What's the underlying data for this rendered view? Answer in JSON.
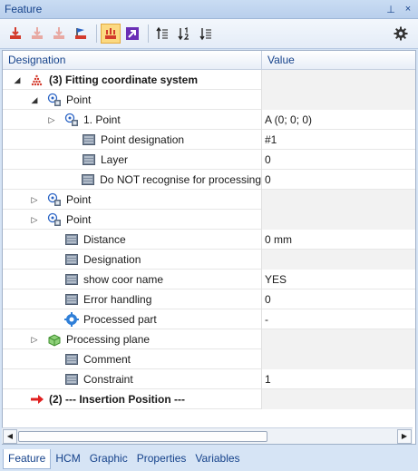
{
  "panel": {
    "title": "Feature",
    "pin_glyph": "⊥",
    "close_glyph": "×"
  },
  "toolbar": {
    "buttons": [
      {
        "icon": "insert-feature-icon"
      },
      {
        "icon": "insert-feature-disabled-icon"
      },
      {
        "icon": "insert-feature-disabled-2-icon"
      },
      {
        "icon": "feature-flag-icon"
      },
      {
        "icon": "feature-active-icon"
      },
      {
        "icon": "arrow-jump-icon"
      },
      {
        "icon": "sort-up-icon"
      },
      {
        "icon": "sort-numeric-icon"
      },
      {
        "icon": "sort-down-icon"
      }
    ],
    "settings_icon": "gear-icon"
  },
  "grid": {
    "columns": [
      "Designation",
      "Value"
    ],
    "rows": [
      {
        "label": "(3) Fitting coordinate system",
        "value": "",
        "bold": true,
        "expander": "open",
        "icon": "coordinate-system-icon",
        "level": 0
      },
      {
        "label": "Point",
        "value": "",
        "expander": "open",
        "icon": "point-icon",
        "level": 1
      },
      {
        "label": "1. Point",
        "value": "A  (0; 0; 0)",
        "expander": "closed",
        "icon": "point-icon",
        "level": 2
      },
      {
        "label": "Point designation",
        "value": "#1",
        "expander": "none",
        "icon": "property-icon",
        "level": 3
      },
      {
        "label": "Layer",
        "value": "0",
        "expander": "none",
        "icon": "property-icon",
        "level": 3
      },
      {
        "label": "Do NOT recognise for processing",
        "value": "0",
        "expander": "none",
        "icon": "property-icon",
        "level": 3
      },
      {
        "label": "Point",
        "value": "",
        "expander": "closed",
        "icon": "point-icon",
        "level": 1
      },
      {
        "label": "Point",
        "value": "",
        "expander": "closed",
        "icon": "point-icon",
        "level": 1
      },
      {
        "label": "Distance",
        "value": "0 mm",
        "expander": "none",
        "icon": "property-icon",
        "level": 2
      },
      {
        "label": "Designation",
        "value": "",
        "expander": "none",
        "icon": "property-icon",
        "level": 2
      },
      {
        "label": "show coor name",
        "value": "YES",
        "expander": "none",
        "icon": "property-icon",
        "level": 2
      },
      {
        "label": "Error handling",
        "value": "0",
        "expander": "none",
        "icon": "property-icon",
        "level": 2
      },
      {
        "label": "Processed part",
        "value": "-",
        "expander": "none",
        "icon": "processed-part-icon",
        "level": 2
      },
      {
        "label": "Processing plane",
        "value": "",
        "expander": "closed",
        "icon": "processing-plane-icon",
        "level": 1
      },
      {
        "label": "Comment",
        "value": "",
        "expander": "none",
        "icon": "property-icon",
        "level": 2
      },
      {
        "label": "Constraint",
        "value": "1",
        "expander": "none",
        "icon": "property-icon",
        "level": 2
      },
      {
        "label": "(2) --- Insertion Position ---",
        "value": "",
        "bold": true,
        "expander": "none",
        "icon": "insertion-arrow-icon",
        "level": 0
      }
    ]
  },
  "scrollbar": {
    "left_glyph": "◀",
    "right_glyph": "▶"
  },
  "tabs": [
    "Feature",
    "HCM",
    "Graphic",
    "Properties",
    "Variables"
  ],
  "active_tab": "Feature",
  "colors": {
    "accent": "#15428b",
    "active_button": "#fbd981",
    "red_icon": "#d33a2c",
    "purple_icon": "#6a2fb5"
  }
}
